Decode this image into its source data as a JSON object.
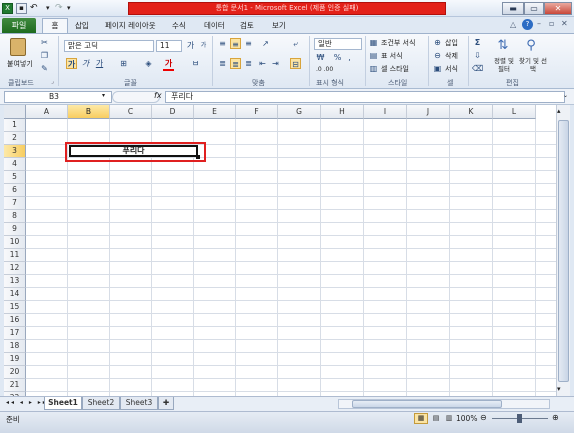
{
  "window": {
    "title": "통합 문서1 - Microsoft Excel (제품 인증 실패)",
    "minimize_glyph": "▬",
    "restore_glyph": "▭",
    "close_glyph": "✕"
  },
  "qat": {
    "save_icon": "save-icon",
    "undo_glyph": "↶",
    "redo_glyph": "↷",
    "more_glyph": "▾"
  },
  "ribbon_tabs": [
    "파일",
    "홈",
    "삽입",
    "페이지 레이아웃",
    "수식",
    "데이터",
    "검토",
    "보기"
  ],
  "ribbon": {
    "clipboard": {
      "paste": "붙여넣기",
      "label": "클립보드"
    },
    "font": {
      "name": "맑은 고딕",
      "size": "11",
      "bold": "가",
      "italic": "가",
      "underline": "가",
      "grow": "가",
      "shrink": "가",
      "label": "글꼴"
    },
    "alignment": {
      "label": "맞춤"
    },
    "number": {
      "format": "일반",
      "percent": "%",
      "comma": ",",
      "inc_dec": ".0 .00",
      "label": "표시 형식"
    },
    "styles": {
      "conditional": "조건부 서식",
      "table": "표 서식",
      "cell": "셀 스타일",
      "label": "스타일"
    },
    "cells": {
      "insert": "삽입",
      "delete": "삭제",
      "format": "서식",
      "label": "셀"
    },
    "editing": {
      "sort": "정렬 및 필터",
      "find": "찾기 및 선택",
      "label": "편집",
      "sum": "Σ"
    }
  },
  "formula_bar": {
    "name_box": "B3",
    "fx": "fx",
    "value": "푸리다"
  },
  "grid": {
    "columns": [
      "A",
      "B",
      "C",
      "D",
      "E",
      "F",
      "G",
      "H",
      "I",
      "J",
      "K",
      "L"
    ],
    "rows": [
      "1",
      "2",
      "3",
      "4",
      "5",
      "6",
      "7",
      "8",
      "9",
      "10",
      "11",
      "12",
      "13",
      "14",
      "15",
      "16",
      "17",
      "18",
      "19",
      "20",
      "21",
      "22"
    ],
    "cell_text": "푸리다",
    "selected_cell": "B3"
  },
  "sheets": [
    "Sheet1",
    "Sheet2",
    "Sheet3"
  ],
  "status": {
    "ready": "준비",
    "zoom": "100%"
  },
  "colors": {
    "highlight_border": "#e02020",
    "title_red": "#e32119",
    "file_tab": "#2a7a2a"
  }
}
